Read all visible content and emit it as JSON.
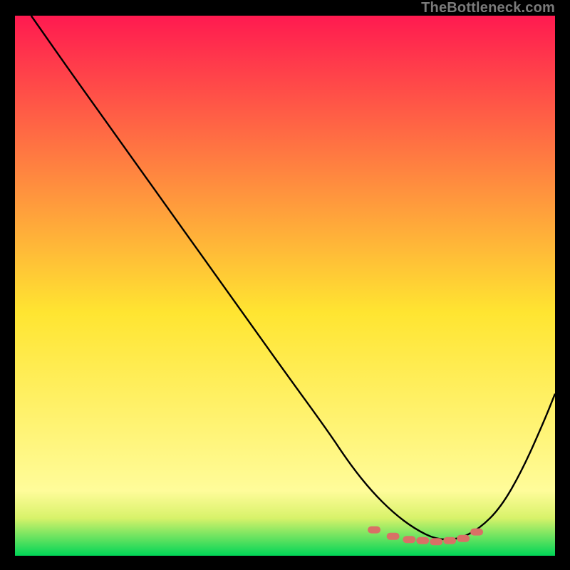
{
  "watermark": "TheBottleneck.com",
  "chart_data": {
    "type": "line",
    "title": "",
    "xlabel": "",
    "ylabel": "",
    "xlim": [
      0,
      100
    ],
    "ylim": [
      0,
      100
    ],
    "grid": false,
    "legend": false,
    "background_gradient": {
      "top_color": "#ff1a50",
      "mid_color": "#ffe531",
      "bottom_color": "#00d557"
    },
    "series": [
      {
        "name": "bottleneck-curve",
        "color": "#000000",
        "x": [
          3,
          10,
          20,
          30,
          40,
          50,
          58,
          62,
          66,
          70,
          74,
          78,
          82,
          86,
          90,
          94,
          98,
          100
        ],
        "y": [
          100,
          90,
          76,
          62,
          48,
          34,
          23,
          17,
          12,
          8,
          5,
          3,
          3,
          5,
          9,
          16,
          25,
          30
        ]
      }
    ],
    "markers": {
      "name": "optimal-range",
      "color": "#d97066",
      "shape": "pill",
      "x": [
        66.5,
        70,
        73,
        75.5,
        78,
        80.5,
        83,
        85.5
      ],
      "y": [
        4.8,
        3.6,
        3.0,
        2.8,
        2.6,
        2.8,
        3.2,
        4.4
      ]
    }
  }
}
